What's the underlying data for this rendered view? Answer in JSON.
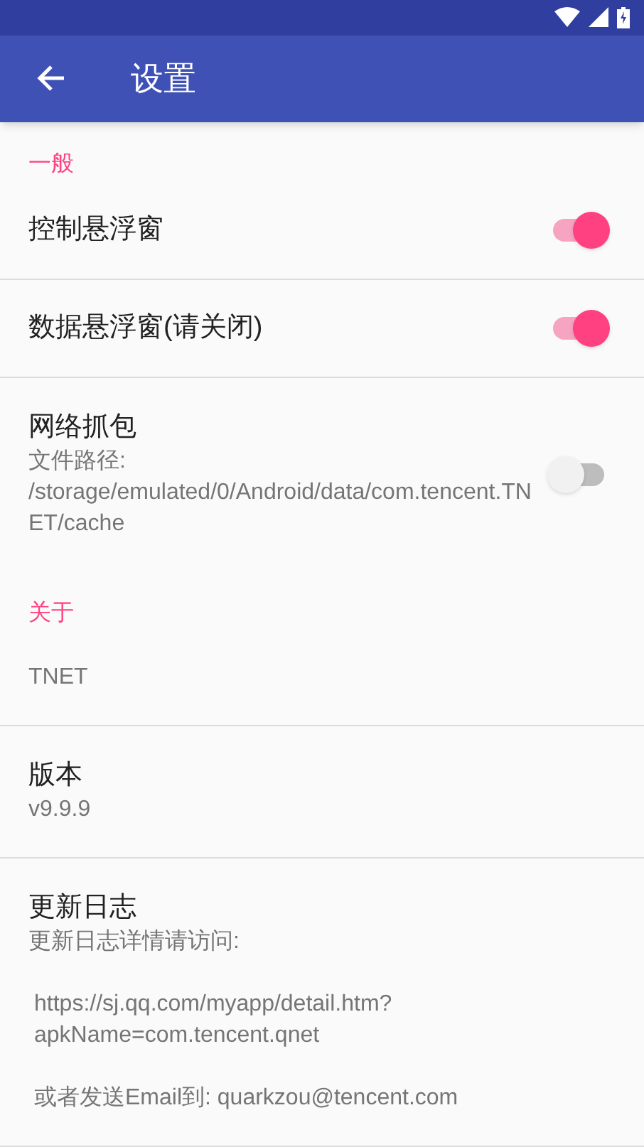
{
  "app_bar": {
    "title": "设置"
  },
  "sections": [
    {
      "header": "一般",
      "items": [
        {
          "kind": "switch",
          "title": "控制悬浮窗",
          "on": true
        },
        {
          "kind": "switch",
          "title": "数据悬浮窗(请关闭)",
          "on": true
        },
        {
          "kind": "switch",
          "title": "网络抓包",
          "summary": "文件路径: /storage/emulated/0/Android/data/com.tencent.TNET/cache",
          "on": false
        }
      ]
    },
    {
      "header": "关于",
      "items": [
        {
          "kind": "info",
          "summary": "TNET"
        },
        {
          "kind": "info",
          "title": "版本",
          "summary": "v9.9.9"
        },
        {
          "kind": "info",
          "title": "更新日志",
          "lines": [
            "更新日志详情请访问:",
            "https://sj.qq.com/myapp/detail.htm?apkName=com.tencent.qnet",
            "或者发送Email到: quarkzou@tencent.com"
          ]
        }
      ]
    }
  ]
}
